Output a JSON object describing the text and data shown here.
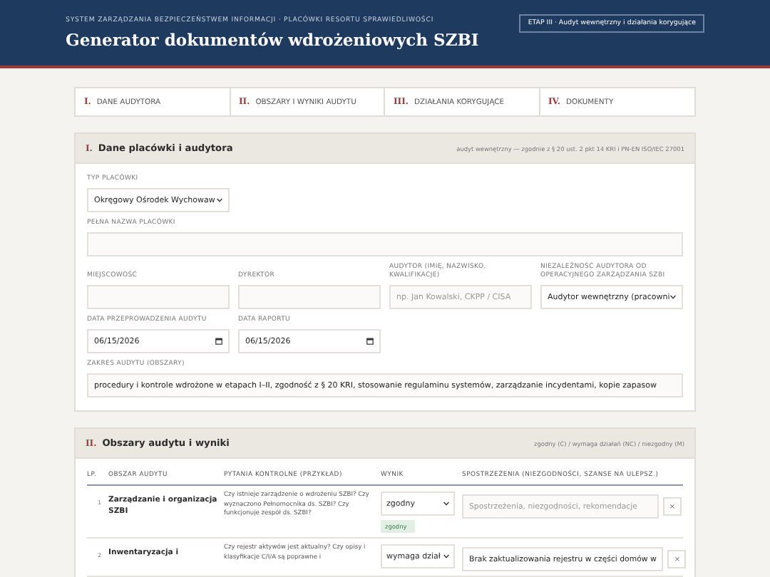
{
  "header": {
    "kicker": "SYSTEM ZARZĄDZANIA BEZPIECZEŃSTWEM INFORMACJI · PLACÓWKI RESORTU SPRAWIEDLIWOŚCI",
    "title": "Generator dokumentów wdrożeniowych SZBI",
    "stage_badge": "ETAP III · Audyt wewnętrzny i działania korygujące"
  },
  "steps": [
    {
      "number": "I.",
      "label": "DANE AUDYTORA",
      "selected": false
    },
    {
      "number": "II.",
      "label": "OBSZARY I WYNIKI AUDYTU",
      "selected": false
    },
    {
      "number": "III.",
      "label": "DZIAŁANIA KORYGUJĄCE",
      "selected": false
    },
    {
      "number": "IV.",
      "label": "DOKUMENTY",
      "selected": false
    }
  ],
  "section_1": {
    "number": "I.",
    "title": "Dane placówki i audytora",
    "note": "audyt wewnętrzny — zgodnie z § 20 ust. 2 pkt 14 KRI i PN-EN ISO/IEC 27001",
    "field_rows": [
      [
        {
          "kind": "select",
          "label": "TYP PLACÓWKI",
          "value": "Okręgowy Ośrodek Wychowaw"
        }
      ],
      [
        {
          "kind": "input",
          "label": "PEŁNA NAZWA PLACÓWKI"
        }
      ],
      [
        {
          "kind": "input",
          "label": "MIEJSCOWOŚĆ"
        },
        {
          "kind": "input",
          "label": "DYREKTOR"
        },
        {
          "kind": "input",
          "label": "AUDYTOR (IMIĘ, NAZWISKO, KWALIFIKACJE)",
          "placeholder": "np. Jan Kowalski, CKPP / CISA"
        },
        {
          "kind": "select",
          "label": "NIEZALEŻNOŚĆ AUDYTORA OD OPERACYJNEGO ZARZĄDZANIA SZBI",
          "value": "Audytor wewnętrzny (pracowni"
        }
      ],
      [
        {
          "kind": "date",
          "label": "DATA PRZEPROWADZENIA AUDYTU",
          "value": "06/15/2026"
        },
        {
          "kind": "date",
          "label": "DATA RAPORTU",
          "value": "06/15/2026"
        }
      ],
      [
        {
          "kind": "input",
          "label": "ZAKRES AUDYTU (OBSZARY)",
          "value": "procedury i kontrole wdrożone w etapach I–II, zgodność z § 20 KRI, stosowanie regulaminu systemów, zarządzanie incydentami, kopie zapasow"
        }
      ]
    ]
  },
  "section_2": {
    "number": "II.",
    "title": "Obszary audytu i wyniki",
    "note": "zgodny (C) / wymaga działań (NC) / niezgodny (M)",
    "columns": [
      "LP.",
      "OBSZAR AUDYTU",
      "PYTANIA KONTROLNE (PRZYKŁAD)",
      "WYNIK",
      "SPOSTRZEŻENIA (NIEZGODNOŚCI, SZANSE NA ULEPSZ.)"
    ],
    "rows": [
      {
        "lp": "1",
        "area": "Zarządzanie i organizacja SZBI",
        "questions": "Czy istnieje zarządzenie o wdrożeniu SZBI? Czy wyznaczono Pełnomocnika ds. SZBI? Czy funkcjonuje zespół ds. SZBI?",
        "result": "zgodny",
        "status_label": "zgodny",
        "observation_placeholder": "Spostrzeżenia, niezgodności, rekomendacje",
        "remove": "×"
      },
      {
        "lp": "2",
        "area": "Inwentaryzacja i",
        "questions": "Czy rejestr aktywów jest aktualny? Czy opisy i klasyfikacje C/I/A są poprawne i",
        "result": "wymaga dział",
        "observation": "Brak zaktualizowania rejestru w części domów w",
        "remove": "×"
      }
    ]
  }
}
